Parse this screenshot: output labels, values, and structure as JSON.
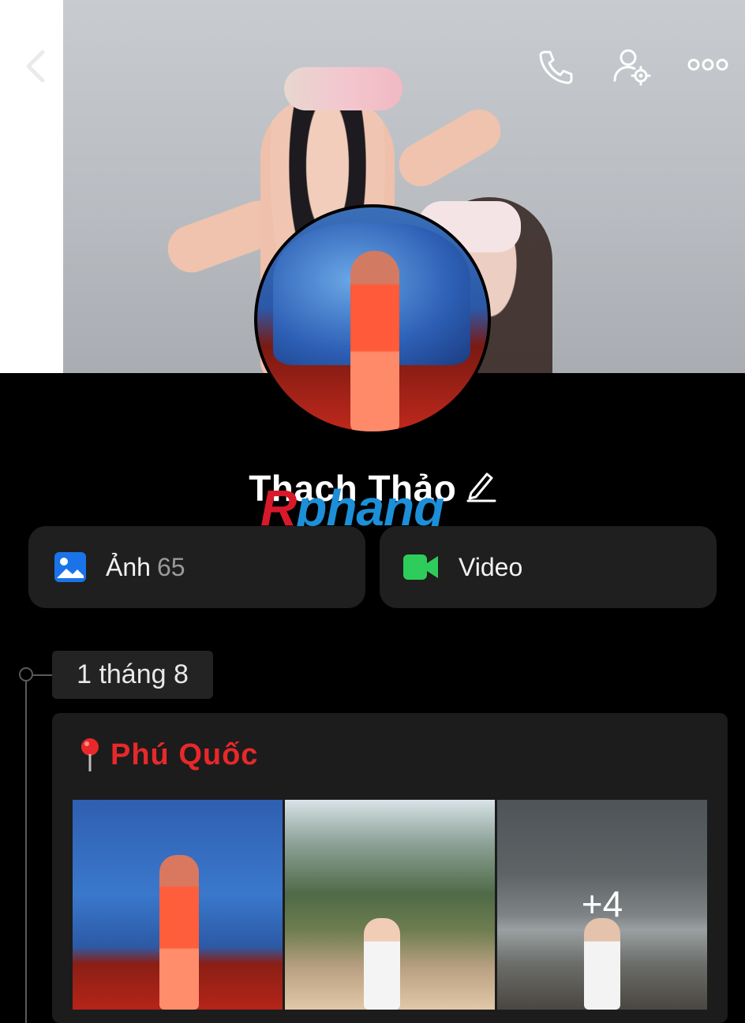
{
  "profile": {
    "name": "Thạch Thảo",
    "watermark_part1": "R",
    "watermark_part2": "phang"
  },
  "header": {
    "icons": [
      "back-chevron-icon",
      "phone-icon",
      "user-settings-icon",
      "more-icon"
    ]
  },
  "media": {
    "photos_label": "Ảnh",
    "photos_count": "65",
    "video_label": "Video"
  },
  "timeline": {
    "date": "1 tháng 8",
    "post": {
      "location": "Phú Quốc",
      "extra_count": "+4"
    }
  },
  "colors": {
    "background": "#000000",
    "card": "#1f1f1f",
    "location_red": "#e8282a",
    "photo_icon_blue": "#1a73e8",
    "video_icon_green": "#2ecc5a"
  }
}
